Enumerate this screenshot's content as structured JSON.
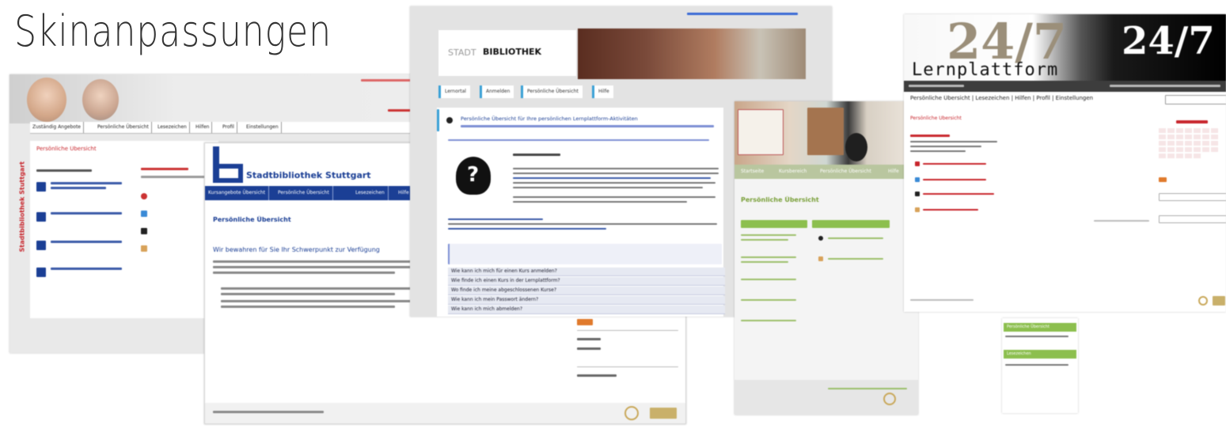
{
  "title": "Skinanpassungen",
  "shot1": {
    "tabs": [
      "Zuständig Angebote",
      "Persönliche Übersicht",
      "Lesezeichen",
      "Hilfen",
      "Profil",
      "Einstellungen"
    ],
    "sidebar_label": "Stadtbibliothek Stuttgart",
    "panel_title": "Persönliche Übersicht"
  },
  "shot2": {
    "brand": "Stadtbibliothek Stuttgart",
    "nav": [
      "Kursangebote Übersicht",
      "Persönliche Übersicht",
      "Lesezeichen",
      "Hilfe"
    ],
    "section": "Persönliche Übersicht",
    "heading": "Wir bewahren für Sie Ihr Schwerpunkt zur Verfügung"
  },
  "shot3": {
    "logo_prefix": "STADT",
    "logo_main": "BIBLIOTHEK",
    "tabs": [
      "Lernortal",
      "Anmelden",
      "Persönliche Übersicht",
      "Hilfe"
    ],
    "headline": "Persönliche Übersicht für Ihre persönlichen Lernplattform-Aktivitäten",
    "list_rows": [
      "Wie kann ich mich für einen Kurs anmelden?",
      "Wie finde ich einen Kurs in der Lernplattform?",
      "Wo finde ich meine abgeschlossenen Kurse?",
      "Wie kann ich mein Passwort ändern?",
      "Wie kann ich mich abmelden?"
    ]
  },
  "shot4": {
    "nav": [
      "Startseite",
      "Kursbereich",
      "Persönliche Übersicht",
      "Hilfe"
    ],
    "section": "Persönliche Übersicht"
  },
  "shot5": {
    "logo_left": "24/7",
    "logo_right": "24/7",
    "brand": "Lernplattform",
    "menu": "Persönliche Übersicht | Lesezeichen | Hilfen | Profil | Einstellungen",
    "section": "Persönliche Übersicht"
  },
  "shot6": {
    "panels": [
      "Persönliche Übersicht",
      "Lesezeichen"
    ]
  },
  "colors": {
    "blue": "#1b3f95",
    "green": "#8cbf4e",
    "red": "#c8262d"
  }
}
